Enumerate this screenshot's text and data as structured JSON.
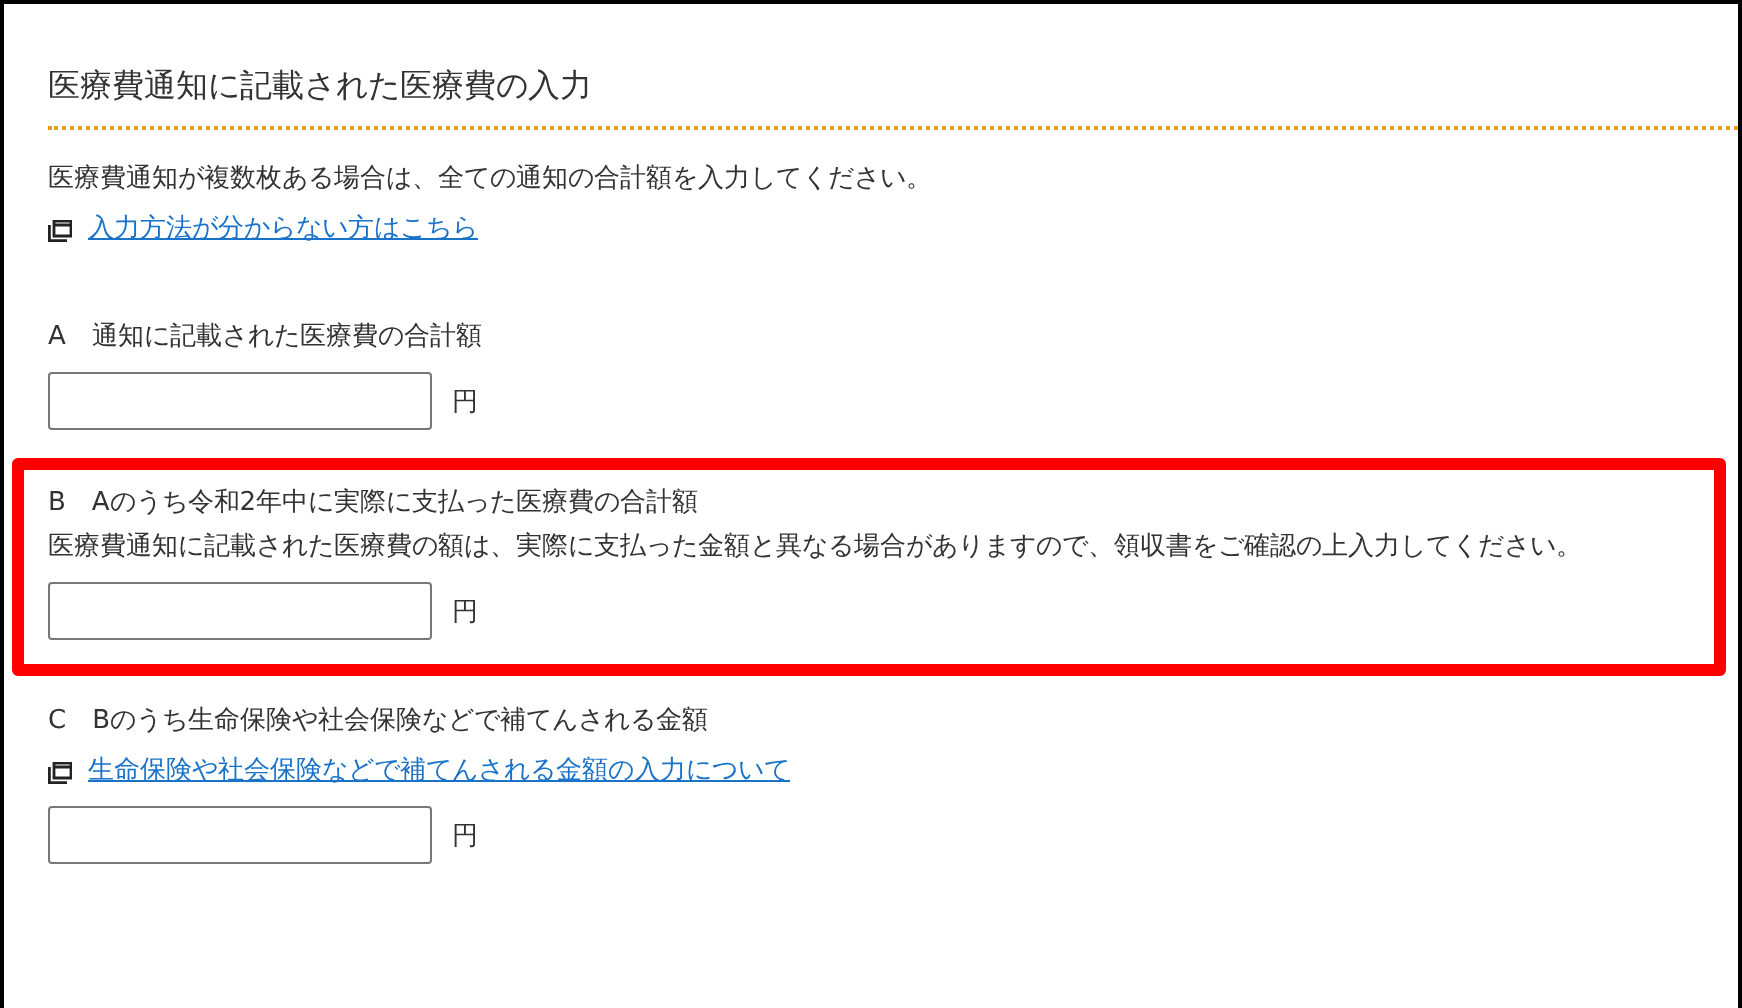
{
  "title": "医療費通知に記載された医療費の入力",
  "intro": "医療費通知が複数枚ある場合は、全ての通知の合計額を入力してください。",
  "intro_link": "入力方法が分からない方はこちら",
  "sections": [
    {
      "label": "A　通知に記載された医療費の合計額",
      "highlighted": false,
      "unit": "円"
    },
    {
      "label": "B　Aのうち令和2年中に実際に支払った医療費の合計額",
      "note": "医療費通知に記載された医療費の額は、実際に支払った金額と異なる場合がありますので、領収書をご確認の上入力してください。",
      "highlighted": true,
      "unit": "円"
    },
    {
      "label": "C　Bのうち生命保険や社会保険などで補てんされる金額",
      "link": "生命保険や社会保険などで補てんされる金額の入力について",
      "highlighted": false,
      "unit": "円"
    }
  ]
}
